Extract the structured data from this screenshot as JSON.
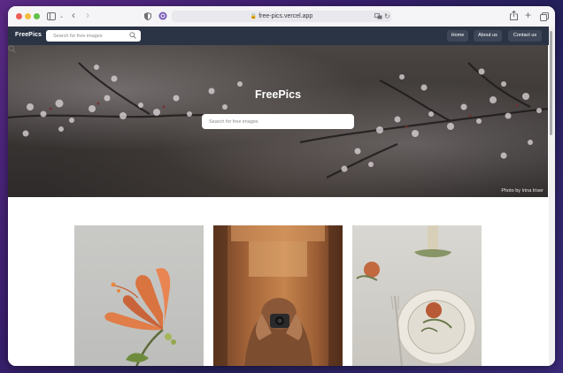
{
  "browser": {
    "url": "free-pics.vercel.app"
  },
  "nav": {
    "brand": "FreePics",
    "search_placeholder": "Search for free images",
    "links": [
      "Home",
      "About us",
      "Contact us"
    ]
  },
  "hero": {
    "title": "FreePics",
    "search_placeholder": "Search for free images",
    "photo_credit": "Photo by Irina Iriser"
  },
  "gallery": {
    "items": [
      {
        "icon": "orange-flower-photo"
      },
      {
        "icon": "photographer-in-hijab-photo"
      },
      {
        "icon": "table-setting-plate-photo"
      }
    ]
  },
  "colors": {
    "nav_bg": "#2b3445",
    "nav_button_bg": "#3e4758",
    "page_bg": "#ffffff"
  }
}
